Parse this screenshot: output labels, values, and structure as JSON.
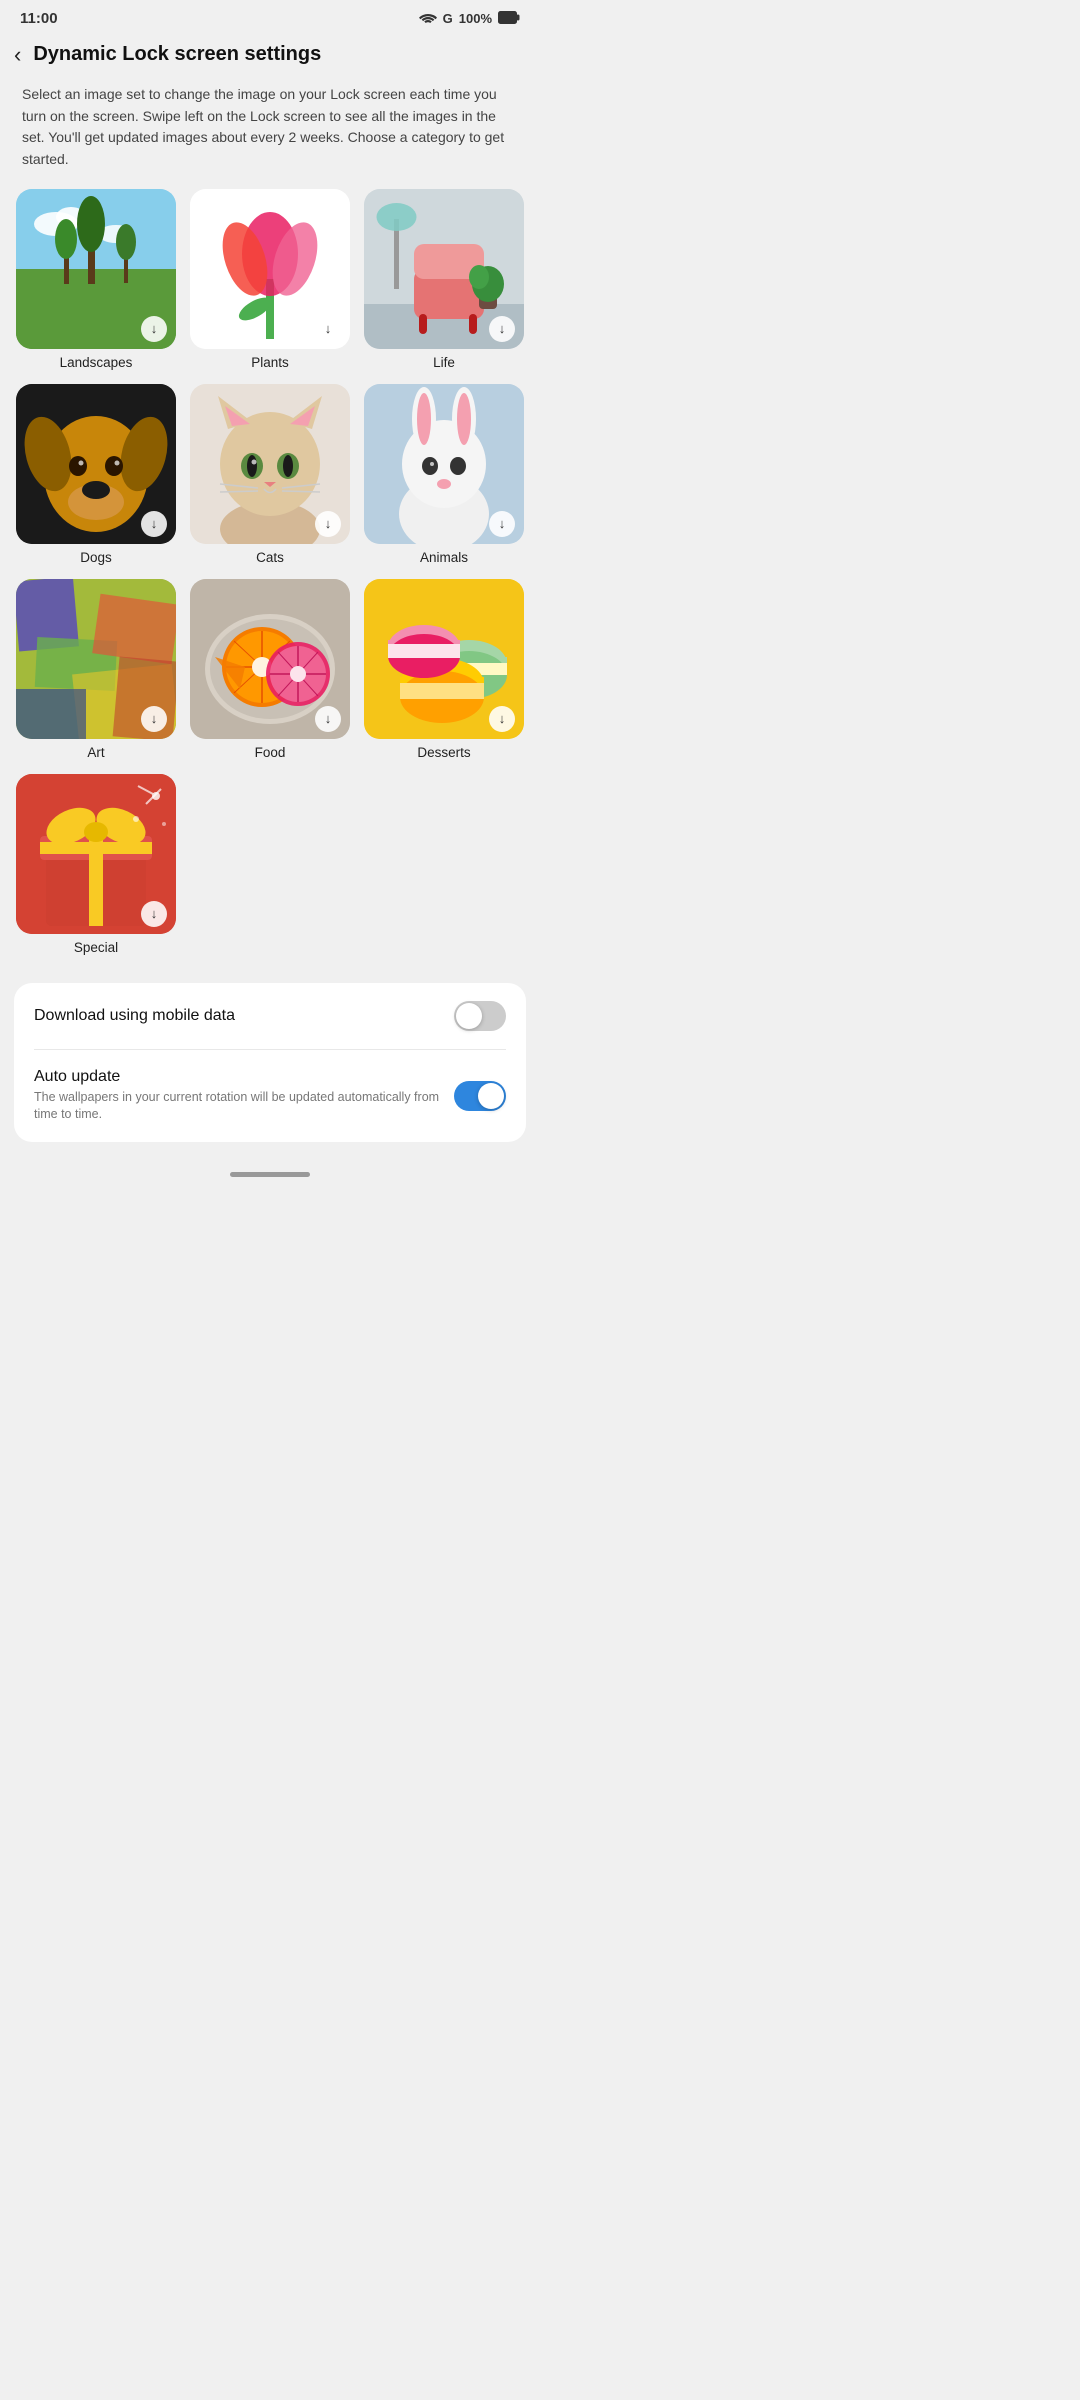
{
  "statusBar": {
    "time": "11:00",
    "battery": "100%",
    "wifi": "wifi",
    "signal": "G"
  },
  "header": {
    "backLabel": "‹",
    "title": "Dynamic Lock screen settings"
  },
  "description": "Select an image set to change the image on your Lock screen each time you turn on the screen. Swipe left on the Lock screen to see all the images in the set. You'll get updated images about every 2 weeks. Choose a category to get started.",
  "grid": {
    "items": [
      {
        "id": "landscapes",
        "label": "Landscapes"
      },
      {
        "id": "plants",
        "label": "Plants"
      },
      {
        "id": "life",
        "label": "Life"
      },
      {
        "id": "dogs",
        "label": "Dogs"
      },
      {
        "id": "cats",
        "label": "Cats"
      },
      {
        "id": "animals",
        "label": "Animals"
      },
      {
        "id": "art",
        "label": "Art"
      },
      {
        "id": "food",
        "label": "Food"
      },
      {
        "id": "desserts",
        "label": "Desserts"
      },
      {
        "id": "special",
        "label": "Special"
      }
    ],
    "downloadIcon": "↓"
  },
  "settings": {
    "mobileData": {
      "label": "Download using mobile data",
      "toggleState": "off"
    },
    "autoUpdate": {
      "label": "Auto update",
      "sublabel": "The wallpapers in your current rotation will be updated automatically from time to time.",
      "toggleState": "on"
    }
  }
}
